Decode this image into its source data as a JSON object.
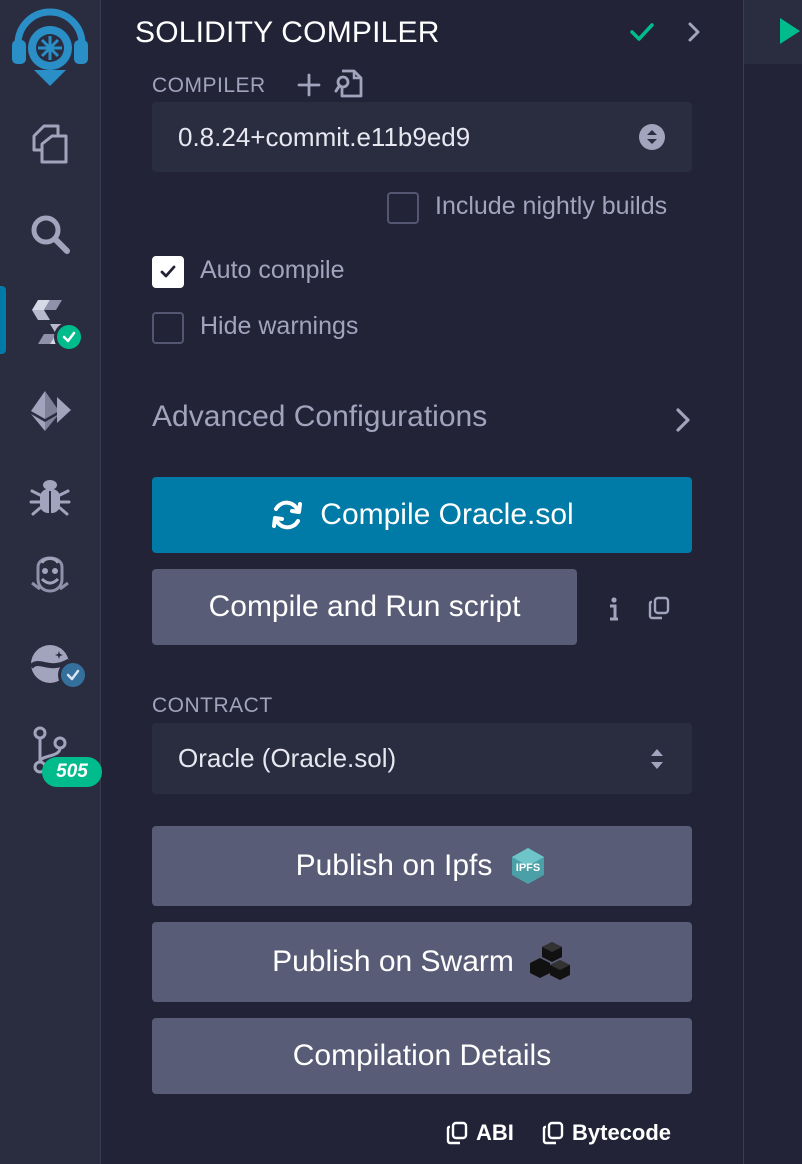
{
  "header": {
    "title": "SOLIDITY COMPILER"
  },
  "compiler": {
    "label": "COMPILER",
    "version": "0.8.24+commit.e11b9ed9",
    "include_nightly_label": "Include nightly builds",
    "include_nightly_checked": false
  },
  "options": {
    "auto_compile_label": "Auto compile",
    "auto_compile_checked": true,
    "hide_warnings_label": "Hide warnings",
    "hide_warnings_checked": false
  },
  "advanced": {
    "label": "Advanced Configurations"
  },
  "actions": {
    "compile_label": "Compile Oracle.sol",
    "compile_run_label": "Compile and Run script"
  },
  "contract": {
    "label": "CONTRACT",
    "selected": "Oracle (Oracle.sol)"
  },
  "publish": {
    "ipfs_label": "Publish on Ipfs",
    "ipfs_badge": "IPFS",
    "swarm_label": "Publish on Swarm",
    "details_label": "Compilation Details"
  },
  "footer": {
    "abi_label": "ABI",
    "bytecode_label": "Bytecode"
  },
  "rail": {
    "items": [
      {
        "icon": "remix-logo-icon"
      },
      {
        "icon": "file-explorer-icon"
      },
      {
        "icon": "search-icon"
      },
      {
        "icon": "solidity-compiler-icon",
        "active": true
      },
      {
        "icon": "deploy-run-icon"
      },
      {
        "icon": "debugger-icon"
      },
      {
        "icon": "solidity-analyzers-icon"
      },
      {
        "icon": "learneth-icon"
      },
      {
        "icon": "git-branch-icon",
        "count": "505"
      }
    ]
  },
  "colors": {
    "primary": "#007aa6",
    "success": "#00bc8c",
    "panel_bg": "#222336",
    "rail_bg": "#2a2c3f",
    "secondary_btn": "#595c76"
  }
}
